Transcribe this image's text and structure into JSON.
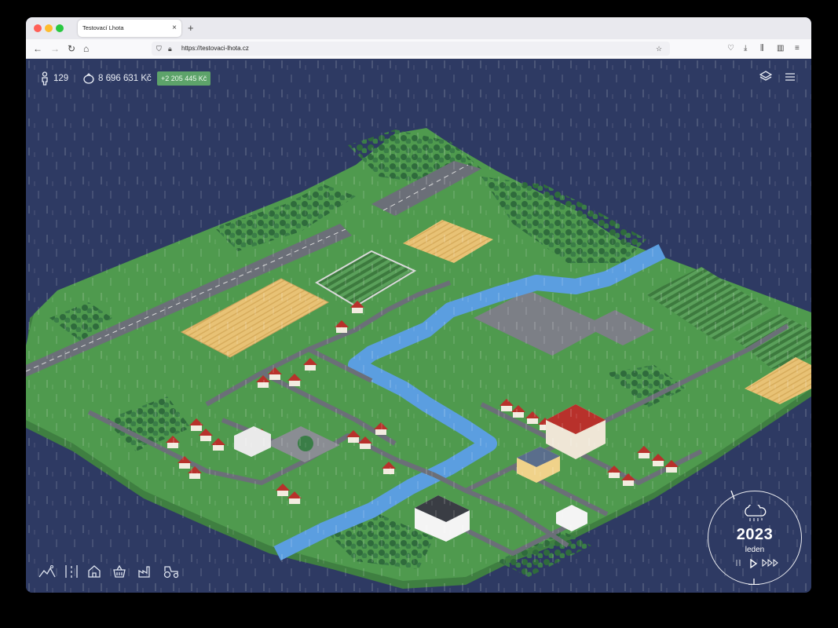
{
  "browser": {
    "tab_title": "Testovací Lhota",
    "url": "https://testovaci-lhota.cz",
    "tab_close": "×",
    "new_tab": "+"
  },
  "hud": {
    "population": "129",
    "money": "8 696 631 Kč",
    "money_delta": "+2 205 445 Kč"
  },
  "clock": {
    "year": "2023",
    "month": "leden",
    "weather_icon": "rain-cloud-icon",
    "controls": [
      "pause-icon",
      "play-icon",
      "fast-forward-icon"
    ]
  },
  "toolbar": {
    "tools": [
      "terrain-icon",
      "roads-icon",
      "housing-icon",
      "shopping-icon",
      "industry-icon",
      "farming-icon"
    ]
  },
  "colors": {
    "water": "#2e3a63",
    "grass": "#4f9a4e",
    "road": "#6b6f78",
    "field": "#e8c275",
    "river": "#5b9ee0",
    "delta_badge": "#5da36a"
  }
}
